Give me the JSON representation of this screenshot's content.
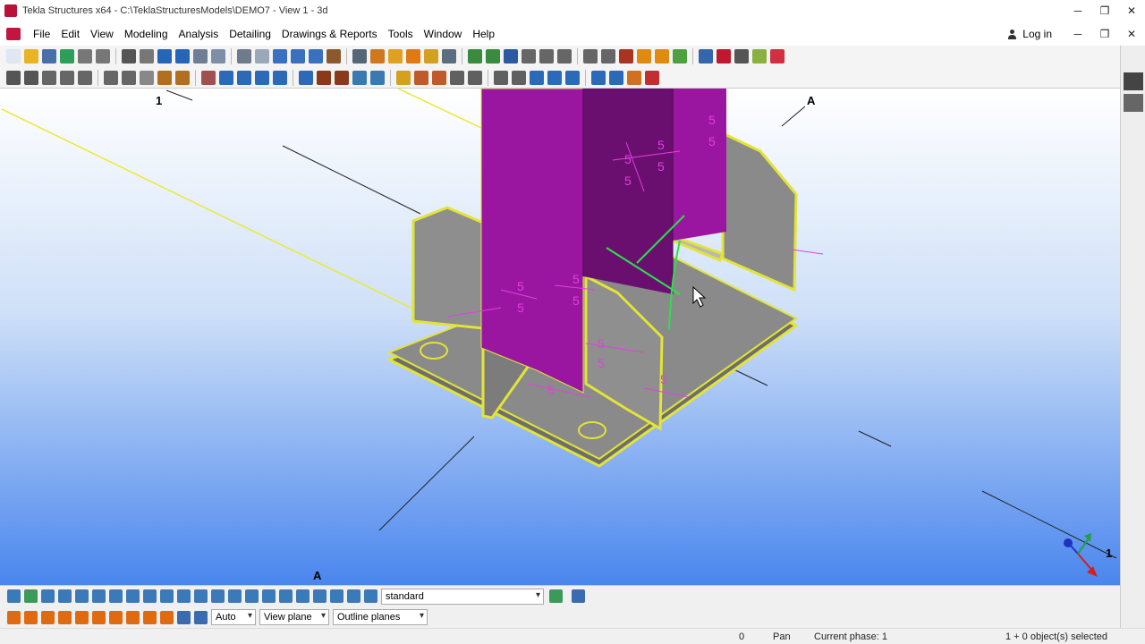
{
  "window": {
    "title": "Tekla Structures x64 - C:\\TeklaStructuresModels\\DEMO7 - View 1 - 3d",
    "minimize": "─",
    "restore": "❐",
    "close": "✕"
  },
  "menu": {
    "items": [
      "File",
      "Edit",
      "View",
      "Modeling",
      "Analysis",
      "Detailing",
      "Drawings & Reports",
      "Tools",
      "Window",
      "Help"
    ],
    "login_label": "Log in",
    "doc_minimize": "─",
    "doc_restore": "❐",
    "doc_close": "✕"
  },
  "toolbar1": {
    "button_colors": [
      "#dfe7f2",
      "#e8b422",
      "#4a6ea8",
      "#2e9e5a",
      "#777777",
      "#777777",
      "#555555",
      "#777777",
      "#2566b8",
      "#2566b8",
      "#6f7f93",
      "#7d8ea8",
      "#6d7b8c",
      "#9aa8b8",
      "#3b6fc0",
      "#3b6fc0",
      "#3b6fc0",
      "#8a5a2e",
      "#556677",
      "#d0781e",
      "#e0a020",
      "#e07a10",
      "#d4a020",
      "#5d6d80",
      "#3a8a40",
      "#3a8a40",
      "#2c5aa0",
      "#666666",
      "#666666",
      "#666666",
      "#666666",
      "#666666",
      "#aa3322",
      "#e08a10",
      "#e08a10",
      "#4fa040",
      "#3366aa",
      "#c0182e",
      "#555555",
      "#8ab040",
      "#d03040"
    ]
  },
  "toolbar2": {
    "button_colors": [
      "#555555",
      "#555555",
      "#666666",
      "#666666",
      "#666666",
      "#666666",
      "#666666",
      "#888888",
      "#b07020",
      "#b07020",
      "#a05050",
      "#2c6ab8",
      "#2c6ab8",
      "#2c6ab8",
      "#2c6ab8",
      "#2c6ab8",
      "#8a3a1a",
      "#8a3a1a",
      "#3a7ab0",
      "#3a7ab0",
      "#d4a020",
      "#c05a2a",
      "#c05a2a",
      "#606060",
      "#606060",
      "#606060",
      "#606060",
      "#2c6ab8",
      "#2c6ab8",
      "#2c6ab8",
      "#2c6ab8",
      "#2c6ab8",
      "#d07020",
      "#c03030"
    ]
  },
  "viewport": {
    "gridlines": [
      {
        "label": "1",
        "position": "top-left"
      },
      {
        "label": "A",
        "position": "top-right"
      },
      {
        "label": "A",
        "position": "bottom-left"
      },
      {
        "label": "1",
        "position": "bottom-right"
      }
    ],
    "weld_size": "5",
    "colors": {
      "column": "#9a16a0",
      "plate": "#8a8a8a",
      "selection": "#e2e436",
      "weld_marks": "#e040e0",
      "sky_top": "#ffffff",
      "sky_bottom": "#4a86ee"
    }
  },
  "bottom1": {
    "select_label": "standard",
    "icon_colors": [
      "#3a7ab8",
      "#3a9a5a",
      "#3a7ab8",
      "#3a7ab8",
      "#3a7ab8",
      "#3a7ab8",
      "#3a7ab8",
      "#3a7ab8",
      "#3a7ab8",
      "#3a7ab8",
      "#3a7ab8",
      "#3a7ab8",
      "#3a7ab8",
      "#3a7ab8",
      "#3a7ab8",
      "#3a7ab8",
      "#3a7ab8",
      "#3a7ab8",
      "#3a7ab8",
      "#3a7ab8",
      "#3a7ab8",
      "#3a7ab8"
    ]
  },
  "bottom2": {
    "icon_colors": [
      "#e06a10",
      "#e06a10",
      "#e06a10",
      "#e06a10",
      "#e06a10",
      "#e06a10",
      "#e06a10",
      "#e06a10",
      "#e06a10",
      "#e06a10",
      "#3a6ab0",
      "#3a6ab0"
    ],
    "selects": [
      "Auto",
      "View plane",
      "Outline planes"
    ]
  },
  "status": {
    "counter": "0",
    "mode": "Pan",
    "phase": "Current phase: 1",
    "selection": "1 + 0 object(s) selected"
  }
}
